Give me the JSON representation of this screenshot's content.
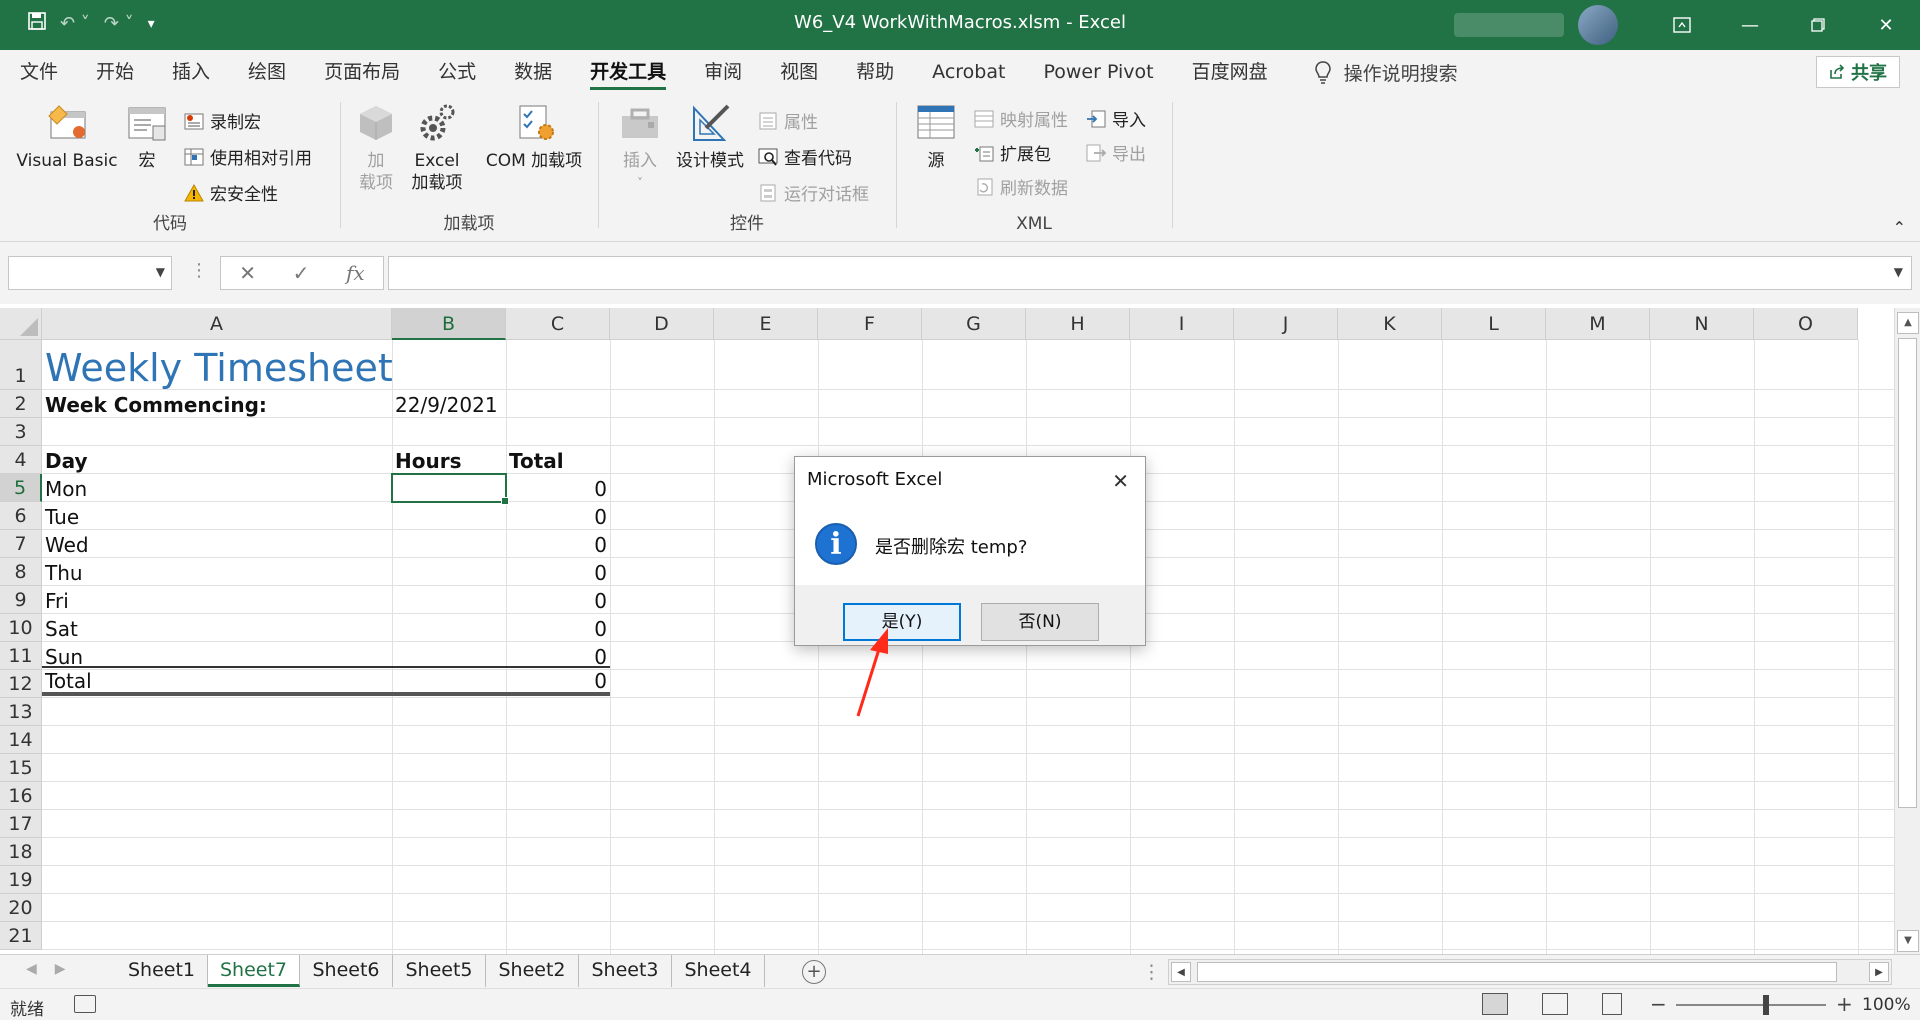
{
  "titlebar": {
    "file_title": "W6_V4 WorkWithMacros.xlsm  -  Excel",
    "icons": [
      "save-icon",
      "undo-icon",
      "redo-icon",
      "customize-icon"
    ]
  },
  "menu": {
    "tabs": [
      "文件",
      "开始",
      "插入",
      "绘图",
      "页面布局",
      "公式",
      "数据",
      "开发工具",
      "审阅",
      "视图",
      "帮助",
      "Acrobat",
      "Power Pivot",
      "百度网盘"
    ],
    "active_tab": "开发工具",
    "tell_me": "操作说明搜索",
    "share": "共享"
  },
  "ribbon": {
    "code": {
      "label": "代码",
      "visual_basic": "Visual Basic",
      "macros": "宏",
      "record_macro": "录制宏",
      "relative_refs": "使用相对引用",
      "macro_security": "宏安全性"
    },
    "addins": {
      "label": "加载项",
      "addins_line1": "加",
      "addins_line2": "载项",
      "excel_addins_line1": "Excel",
      "excel_addins_line2": "加载项",
      "com_addins": "COM 加载项"
    },
    "controls": {
      "label": "控件",
      "insert": "插入",
      "design_mode": "设计模式",
      "properties": "属性",
      "view_code": "查看代码",
      "run_dialog": "运行对话框"
    },
    "xml": {
      "label": "XML",
      "source": "源",
      "map_properties": "映射属性",
      "expansion_packs": "扩展包",
      "refresh_data": "刷新数据",
      "import": "导入",
      "export": "导出"
    }
  },
  "formula_bar": {
    "name_box": "",
    "cancel": "✕",
    "enter": "✓",
    "fx": "fx",
    "value": ""
  },
  "grid": {
    "columns": [
      "A",
      "B",
      "C",
      "D",
      "E",
      "F",
      "G",
      "H",
      "I",
      "J",
      "K",
      "L",
      "M",
      "N",
      "O"
    ],
    "rows": [
      "1",
      "2",
      "3",
      "4",
      "5",
      "6",
      "7",
      "8",
      "9",
      "10",
      "11",
      "12",
      "13",
      "14",
      "15",
      "16",
      "17",
      "18",
      "19",
      "20",
      "21"
    ],
    "selected_column": "B",
    "selected_row": "5"
  },
  "sheet": {
    "title": "Weekly Timesheet",
    "week_label": "Week Commencing:",
    "week_value": "22/9/2021",
    "col_day": "Day",
    "col_hours": "Hours",
    "col_total": "Total",
    "days": [
      {
        "day": "Mon",
        "total": "0"
      },
      {
        "day": "Tue",
        "total": "0"
      },
      {
        "day": "Wed",
        "total": "0"
      },
      {
        "day": "Thu",
        "total": "0"
      },
      {
        "day": "Fri",
        "total": "0"
      },
      {
        "day": "Sat",
        "total": "0"
      },
      {
        "day": "Sun",
        "total": "0"
      }
    ],
    "total_label": "Total",
    "grand_total": "0"
  },
  "tabs": {
    "sheets": [
      "Sheet1",
      "Sheet7",
      "Sheet6",
      "Sheet5",
      "Sheet2",
      "Sheet3",
      "Sheet4"
    ],
    "active": "Sheet7"
  },
  "status": {
    "ready": "就绪",
    "zoom_minus": "−",
    "zoom_plus": "+",
    "zoom": "100%",
    "zoom_fraction": 0.6
  },
  "dialog": {
    "title": "Microsoft Excel",
    "message": "是否删除宏 temp?",
    "yes": "是(Y)",
    "no": "否(N)",
    "info_glyph": "i",
    "close": "✕"
  },
  "colors": {
    "excel_green": "#217346",
    "title_blue": "#2f75b5",
    "annotation_red": "#ff2a1a"
  }
}
